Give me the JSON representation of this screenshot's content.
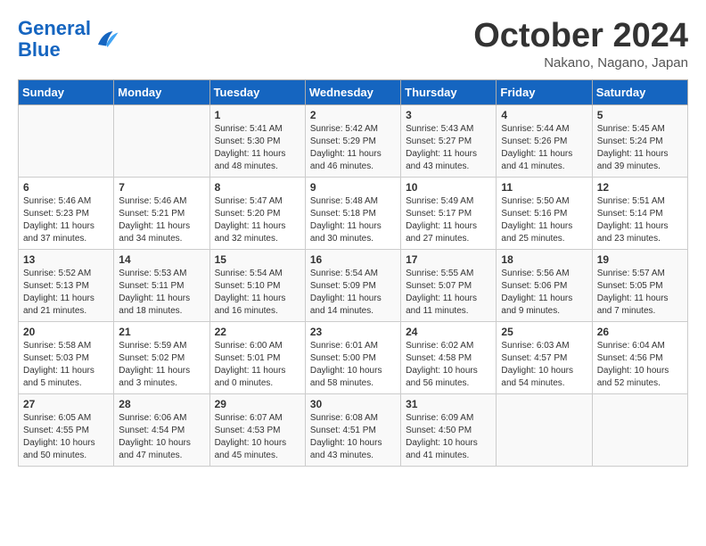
{
  "header": {
    "logo_line1": "General",
    "logo_line2": "Blue",
    "month": "October 2024",
    "location": "Nakano, Nagano, Japan"
  },
  "days_of_week": [
    "Sunday",
    "Monday",
    "Tuesday",
    "Wednesday",
    "Thursday",
    "Friday",
    "Saturday"
  ],
  "weeks": [
    [
      {
        "day": "",
        "content": ""
      },
      {
        "day": "",
        "content": ""
      },
      {
        "day": "1",
        "content": "Sunrise: 5:41 AM\nSunset: 5:30 PM\nDaylight: 11 hours and 48 minutes."
      },
      {
        "day": "2",
        "content": "Sunrise: 5:42 AM\nSunset: 5:29 PM\nDaylight: 11 hours and 46 minutes."
      },
      {
        "day": "3",
        "content": "Sunrise: 5:43 AM\nSunset: 5:27 PM\nDaylight: 11 hours and 43 minutes."
      },
      {
        "day": "4",
        "content": "Sunrise: 5:44 AM\nSunset: 5:26 PM\nDaylight: 11 hours and 41 minutes."
      },
      {
        "day": "5",
        "content": "Sunrise: 5:45 AM\nSunset: 5:24 PM\nDaylight: 11 hours and 39 minutes."
      }
    ],
    [
      {
        "day": "6",
        "content": "Sunrise: 5:46 AM\nSunset: 5:23 PM\nDaylight: 11 hours and 37 minutes."
      },
      {
        "day": "7",
        "content": "Sunrise: 5:46 AM\nSunset: 5:21 PM\nDaylight: 11 hours and 34 minutes."
      },
      {
        "day": "8",
        "content": "Sunrise: 5:47 AM\nSunset: 5:20 PM\nDaylight: 11 hours and 32 minutes."
      },
      {
        "day": "9",
        "content": "Sunrise: 5:48 AM\nSunset: 5:18 PM\nDaylight: 11 hours and 30 minutes."
      },
      {
        "day": "10",
        "content": "Sunrise: 5:49 AM\nSunset: 5:17 PM\nDaylight: 11 hours and 27 minutes."
      },
      {
        "day": "11",
        "content": "Sunrise: 5:50 AM\nSunset: 5:16 PM\nDaylight: 11 hours and 25 minutes."
      },
      {
        "day": "12",
        "content": "Sunrise: 5:51 AM\nSunset: 5:14 PM\nDaylight: 11 hours and 23 minutes."
      }
    ],
    [
      {
        "day": "13",
        "content": "Sunrise: 5:52 AM\nSunset: 5:13 PM\nDaylight: 11 hours and 21 minutes."
      },
      {
        "day": "14",
        "content": "Sunrise: 5:53 AM\nSunset: 5:11 PM\nDaylight: 11 hours and 18 minutes."
      },
      {
        "day": "15",
        "content": "Sunrise: 5:54 AM\nSunset: 5:10 PM\nDaylight: 11 hours and 16 minutes."
      },
      {
        "day": "16",
        "content": "Sunrise: 5:54 AM\nSunset: 5:09 PM\nDaylight: 11 hours and 14 minutes."
      },
      {
        "day": "17",
        "content": "Sunrise: 5:55 AM\nSunset: 5:07 PM\nDaylight: 11 hours and 11 minutes."
      },
      {
        "day": "18",
        "content": "Sunrise: 5:56 AM\nSunset: 5:06 PM\nDaylight: 11 hours and 9 minutes."
      },
      {
        "day": "19",
        "content": "Sunrise: 5:57 AM\nSunset: 5:05 PM\nDaylight: 11 hours and 7 minutes."
      }
    ],
    [
      {
        "day": "20",
        "content": "Sunrise: 5:58 AM\nSunset: 5:03 PM\nDaylight: 11 hours and 5 minutes."
      },
      {
        "day": "21",
        "content": "Sunrise: 5:59 AM\nSunset: 5:02 PM\nDaylight: 11 hours and 3 minutes."
      },
      {
        "day": "22",
        "content": "Sunrise: 6:00 AM\nSunset: 5:01 PM\nDaylight: 11 hours and 0 minutes."
      },
      {
        "day": "23",
        "content": "Sunrise: 6:01 AM\nSunset: 5:00 PM\nDaylight: 10 hours and 58 minutes."
      },
      {
        "day": "24",
        "content": "Sunrise: 6:02 AM\nSunset: 4:58 PM\nDaylight: 10 hours and 56 minutes."
      },
      {
        "day": "25",
        "content": "Sunrise: 6:03 AM\nSunset: 4:57 PM\nDaylight: 10 hours and 54 minutes."
      },
      {
        "day": "26",
        "content": "Sunrise: 6:04 AM\nSunset: 4:56 PM\nDaylight: 10 hours and 52 minutes."
      }
    ],
    [
      {
        "day": "27",
        "content": "Sunrise: 6:05 AM\nSunset: 4:55 PM\nDaylight: 10 hours and 50 minutes."
      },
      {
        "day": "28",
        "content": "Sunrise: 6:06 AM\nSunset: 4:54 PM\nDaylight: 10 hours and 47 minutes."
      },
      {
        "day": "29",
        "content": "Sunrise: 6:07 AM\nSunset: 4:53 PM\nDaylight: 10 hours and 45 minutes."
      },
      {
        "day": "30",
        "content": "Sunrise: 6:08 AM\nSunset: 4:51 PM\nDaylight: 10 hours and 43 minutes."
      },
      {
        "day": "31",
        "content": "Sunrise: 6:09 AM\nSunset: 4:50 PM\nDaylight: 10 hours and 41 minutes."
      },
      {
        "day": "",
        "content": ""
      },
      {
        "day": "",
        "content": ""
      }
    ]
  ]
}
